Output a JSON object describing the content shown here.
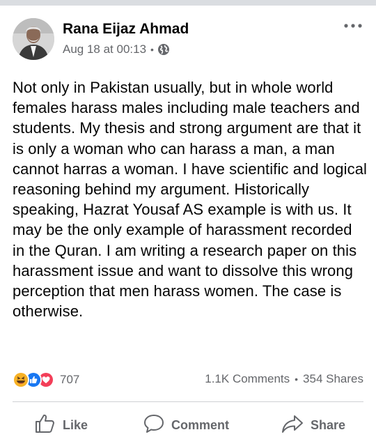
{
  "post": {
    "author": "Rana Eijaz Ahmad",
    "timestamp": "Aug 18 at 00:13",
    "separator": "•",
    "privacy_icon": "globe-icon",
    "more_icon": "more-options-icon",
    "body": "Not only in Pakistan usually, but in whole world females harass males including male teachers and students. My thesis and strong argument are that it is only a woman who can harass a man, a man cannot harras a woman. I have scientific and logical reasoning behind my argument. Historically speaking, Hazrat Yousaf AS example is with us. It may be the only example of harassment recorded in the Quran. I am writing a research paper on this harassment issue and want to dissolve this wrong perception that men harass women. The case is otherwise."
  },
  "stats": {
    "reaction_icons": [
      "haha-icon",
      "like-icon",
      "love-icon"
    ],
    "reaction_count": "707",
    "comments": "1.1K Comments",
    "separator": "•",
    "shares": "354 Shares"
  },
  "actions": {
    "like_label": "Like",
    "comment_label": "Comment",
    "share_label": "Share"
  },
  "colors": {
    "text": "#050505",
    "secondary": "#65676b",
    "like_blue": "#1877f2",
    "love_red": "#f33e58",
    "haha_yellow": "#f7b125",
    "divider": "#ced0d4"
  }
}
